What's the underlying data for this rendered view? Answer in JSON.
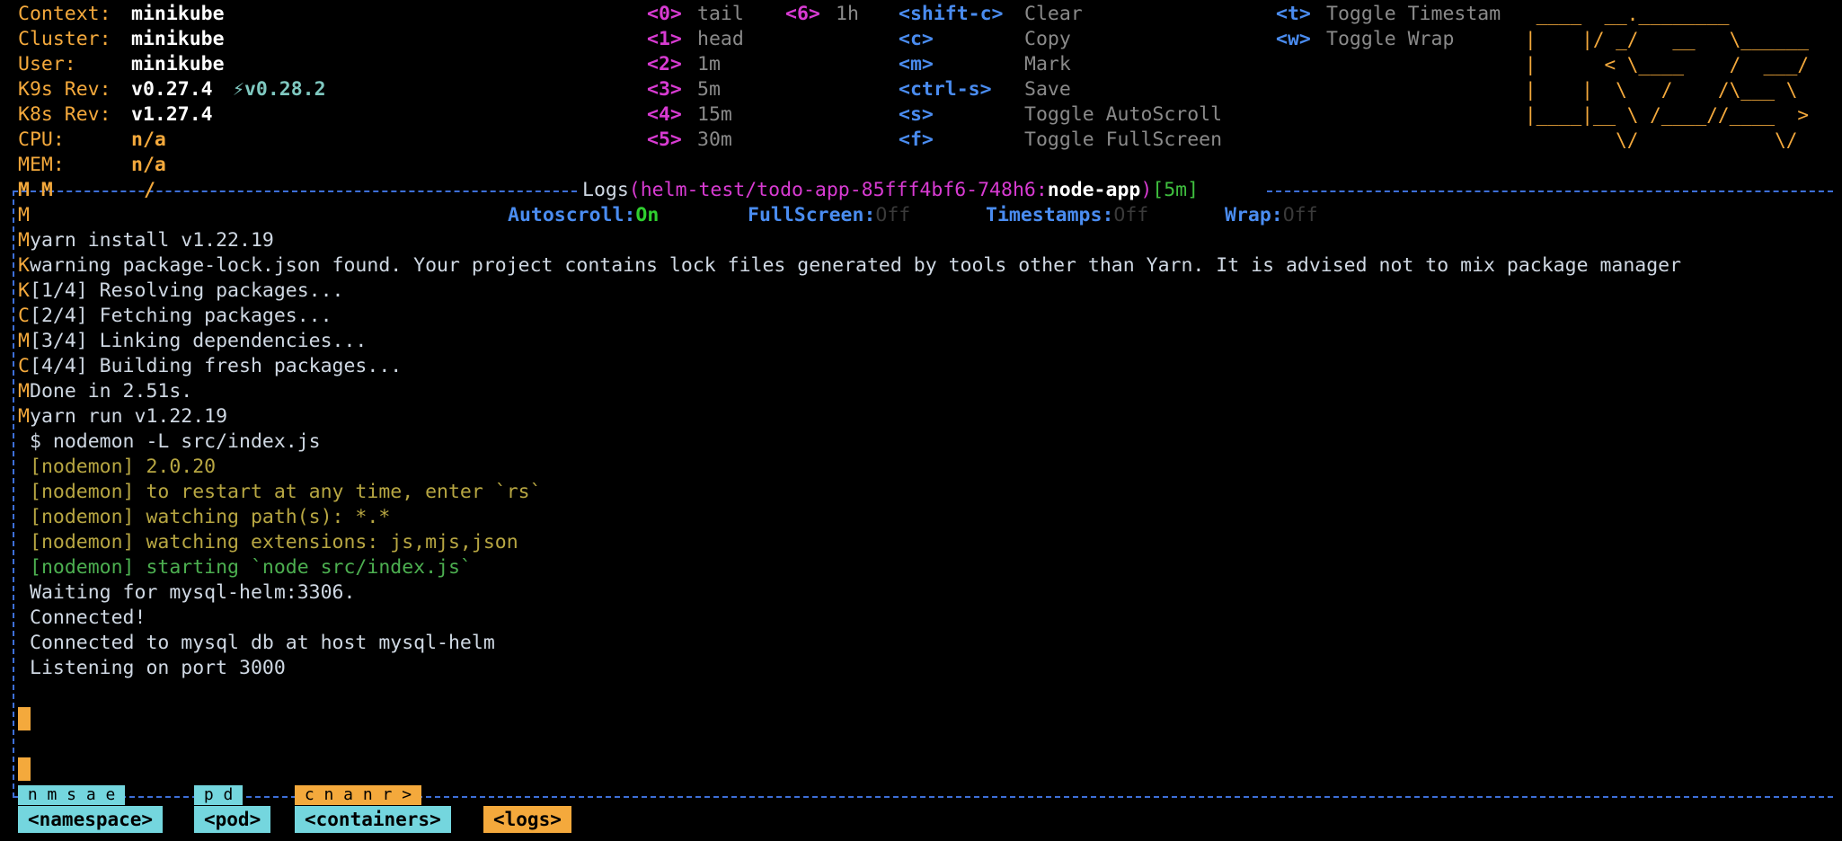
{
  "info": [
    {
      "label": "Context:",
      "value": "minikube"
    },
    {
      "label": "Cluster:",
      "value": "minikube"
    },
    {
      "label": "User:",
      "value": "minikube"
    },
    {
      "label": "K9s Rev:",
      "value": "v0.27.4",
      "extra": "⚡v0.28.2"
    },
    {
      "label": "K8s Rev:",
      "value": "v1.27.4"
    },
    {
      "label": "CPU:",
      "value": "n/a"
    },
    {
      "label": "MEM:",
      "value": "n/a"
    }
  ],
  "shortcuts_col1": [
    {
      "key": "<0>",
      "action": "tail"
    },
    {
      "key": "<1>",
      "action": "head"
    },
    {
      "key": "<2>",
      "action": "1m"
    },
    {
      "key": "<3>",
      "action": "5m"
    },
    {
      "key": "<4>",
      "action": "15m"
    },
    {
      "key": "<5>",
      "action": "30m"
    }
  ],
  "shortcuts_col2": [
    {
      "key": "<6>",
      "action": "1h"
    }
  ],
  "shortcuts_col3": [
    {
      "key": "<shift-c>",
      "action": "Clear"
    },
    {
      "key": "<c>",
      "action": "Copy"
    },
    {
      "key": "<m>",
      "action": "Mark"
    },
    {
      "key": "<ctrl-s>",
      "action": "Save"
    },
    {
      "key": "<s>",
      "action": "Toggle AutoScroll"
    },
    {
      "key": "<f>",
      "action": "Toggle FullScreen"
    }
  ],
  "shortcuts_col4": [
    {
      "key": "<t>",
      "action": "Toggle Timestam"
    },
    {
      "key": "<w>",
      "action": "Toggle Wrap"
    }
  ],
  "logo_lines": [
    " ____  __.________       ",
    "|    |/ _/   __   \\______",
    "|      < \\____    /  ___/",
    "|    |  \\   /    /\\___ \\ ",
    "|____|__ \\ /____//____  >",
    "        \\/            \\/ "
  ],
  "title": {
    "word": "Logs",
    "open": "(",
    "path": "helm-test/todo-app-85fff4bf6-748h6:",
    "container": "node-app",
    "close": ")",
    "range": "[5m]"
  },
  "status": {
    "autoscroll_label": "Autoscroll:",
    "autoscroll_value": "On",
    "fullscreen_label": "FullScreen:",
    "fullscreen_value": "Off",
    "timestamps_label": "Timestamps:",
    "timestamps_value": "Off",
    "wrap_label": "Wrap:",
    "wrap_value": "Off"
  },
  "logs": [
    {
      "prefix": "M",
      "text": "yarn install v1.22.19",
      "color": "normal"
    },
    {
      "prefix": "K",
      "text": "warning package-lock.json found. Your project contains lock files generated by tools other than Yarn. It is advised not to mix package manager",
      "color": "normal"
    },
    {
      "prefix": "K",
      "text": "[1/4] Resolving packages...",
      "color": "normal"
    },
    {
      "prefix": "C",
      "text": "[2/4] Fetching packages...",
      "color": "normal"
    },
    {
      "prefix": "M",
      "text": "[3/4] Linking dependencies...",
      "color": "normal"
    },
    {
      "prefix": "C",
      "text": "[4/4] Building fresh packages...",
      "color": "normal"
    },
    {
      "prefix": "M",
      "text": "Done in 2.51s.",
      "color": "normal"
    },
    {
      "prefix": "M",
      "text": "yarn run v1.22.19",
      "color": "normal"
    },
    {
      "prefix": " ",
      "text": "$ nodemon -L src/index.js",
      "color": "normal"
    },
    {
      "prefix": " ",
      "text": "[nodemon] 2.0.20",
      "color": "yellow"
    },
    {
      "prefix": " ",
      "text": "[nodemon] to restart at any time, enter `rs`",
      "color": "yellow"
    },
    {
      "prefix": " ",
      "text": "[nodemon] watching path(s): *.*",
      "color": "yellow"
    },
    {
      "prefix": " ",
      "text": "[nodemon] watching extensions: js,mjs,json",
      "color": "yellow"
    },
    {
      "prefix": " ",
      "text": "[nodemon] starting `node src/index.js`",
      "color": "green"
    },
    {
      "prefix": " ",
      "text": "Waiting for mysql-helm:3306.",
      "color": "normal"
    },
    {
      "prefix": " ",
      "text": "Connected!",
      "color": "normal"
    },
    {
      "prefix": " ",
      "text": "Connected to mysql db at host mysql-helm",
      "color": "normal"
    },
    {
      "prefix": " ",
      "text": "Listening on port 3000",
      "color": "normal"
    }
  ],
  "frame_top_left": "M M",
  "frame_slash": "/",
  "first_prefix": "M",
  "breadcrumbs": [
    "<namespace>",
    "<pod>",
    "<containers>",
    "<logs>"
  ],
  "tab_markers": [
    {
      "text": " n m s a e ",
      "color": "teal"
    },
    {
      "text": " p d ",
      "color": "teal"
    },
    {
      "text": " c n a n r > ",
      "color": "orange"
    }
  ]
}
